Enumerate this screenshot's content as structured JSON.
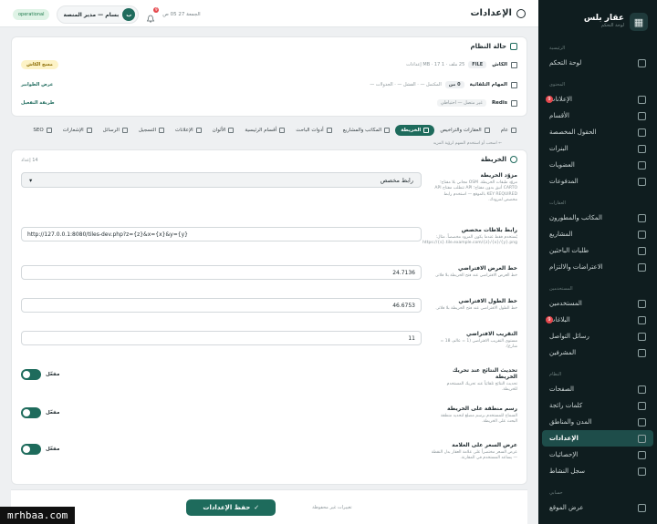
{
  "sidebar": {
    "brand": {
      "name": "عقار بلس",
      "sub": "لوحة التحكم"
    },
    "sections": [
      {
        "title": "الرئيسية",
        "items": [
          {
            "label": "لوحة التحكم",
            "badge": ""
          }
        ]
      },
      {
        "title": "المحتوى",
        "items": [
          {
            "label": "الإعلانات",
            "badge": "9"
          },
          {
            "label": "الأقسام",
            "badge": ""
          },
          {
            "label": "الحقول المخصصة",
            "badge": ""
          },
          {
            "label": "البنرات",
            "badge": ""
          },
          {
            "label": "العضويات",
            "badge": ""
          },
          {
            "label": "المدفوعات",
            "badge": ""
          }
        ]
      },
      {
        "title": "العقارات",
        "items": [
          {
            "label": "المكاتب والمطورون",
            "badge": ""
          },
          {
            "label": "المشاريع",
            "badge": ""
          },
          {
            "label": "طلبات الباحثين",
            "badge": ""
          },
          {
            "label": "الاعتراضات والالتزام",
            "badge": ""
          }
        ]
      },
      {
        "title": "المستخدمين",
        "items": [
          {
            "label": "المستخدمين",
            "badge": ""
          },
          {
            "label": "البلاغات",
            "badge": "9"
          },
          {
            "label": "رسائل التواصل",
            "badge": ""
          },
          {
            "label": "المشرفين",
            "badge": ""
          }
        ]
      },
      {
        "title": "النظام",
        "items": [
          {
            "label": "الصفحات",
            "badge": ""
          },
          {
            "label": "كلمات رائجة",
            "badge": ""
          },
          {
            "label": "المدن والمناطق",
            "badge": ""
          },
          {
            "label": "الإعدادات",
            "badge": "",
            "active": true
          },
          {
            "label": "الإحصائيات",
            "badge": ""
          },
          {
            "label": "سجل النشاط",
            "badge": ""
          }
        ]
      },
      {
        "title": "حسابي",
        "items": [
          {
            "label": "عرض الموقع",
            "badge": ""
          }
        ]
      }
    ]
  },
  "topbar": {
    "title": "الإعدادات",
    "date": "الجمعة 27 05 ص",
    "notif_count": "9",
    "user": "بسام — مدير المنصة",
    "avatar_letter": "ب",
    "status": "operational"
  },
  "system": {
    "title": "حالة النظام",
    "rows": [
      {
        "key": "الكاش",
        "chips": [
          "FILE"
        ],
        "meta": "25 ملف · 1 MB · 17 إعدادات",
        "action": "مسح الكاش"
      },
      {
        "key": "المهام التلقائية",
        "chips": [
          "0 من"
        ],
        "meta": "المكتمل — · الفشل — · الجدولات —",
        "action": "عرض الطوابير"
      },
      {
        "key": "Redis",
        "chips": [
          "غير متصل — احتياطي"
        ],
        "meta": "",
        "action": "طريقة التفعيل"
      }
    ]
  },
  "tabs": [
    {
      "label": "عام",
      "active": false
    },
    {
      "label": "العقارات والتراخيص",
      "active": false
    },
    {
      "label": "الخريطة",
      "active": true
    },
    {
      "label": "المكاتب والمشاريع",
      "active": false
    },
    {
      "label": "أدوات الباحث",
      "active": false
    },
    {
      "label": "أقسام الرئيسية",
      "active": false
    },
    {
      "label": "الألوان",
      "active": false
    },
    {
      "label": "الإعلانات",
      "active": false
    },
    {
      "label": "التسجيل",
      "active": false
    },
    {
      "label": "الرسائل",
      "active": false
    },
    {
      "label": "الإشعارات",
      "active": false
    },
    {
      "label": "SEO",
      "active": false
    }
  ],
  "hint": "← اسحب أو استخدم السهم لرؤية المزيد",
  "map": {
    "title": "الخريطة",
    "count": "14 إعداد",
    "fields": [
      {
        "label": "مزوّد الخريطة",
        "desc": "مزوّد طبقات الخريطة. OSM مجاني بلا مفتاح؛ CARTO أنيق بدون مفتاح؛ API تتطلب مفتاح API KEY REQUIRED بالموقع — استخدم رابط مخصص لمزودك.",
        "type": "select",
        "value": "رابط مخصص"
      },
      {
        "label": "رابط بلاطات مخصص",
        "desc": "يُستخدم فقط عندما يكون المزود مخصصاً. مثال: https://{s}.tile.example.com/{z}/{x}/{y}.png",
        "type": "input",
        "value": "http://127.0.0.1:8080/tiles-dev.php?z={z}&x={x}&y={y}"
      },
      {
        "label": "خط العرض الافتراضي",
        "desc": "خط العرض الافتراضي عند فتح الخريطة بلا فلاتر.",
        "type": "input",
        "value": "24.7136"
      },
      {
        "label": "خط الطول الافتراضي",
        "desc": "خط الطول الافتراضي عند فتح الخريطة بلا فلاتر.",
        "type": "input",
        "value": "46.6753"
      },
      {
        "label": "التقريب الافتراضي",
        "desc": "مستوى التقريب الافتراضي (1 = عالم، 18 = شارع).",
        "type": "input",
        "value": "11"
      },
      {
        "label": "تحديث النتائج عند تحريك الخريطة",
        "desc": "تحديث النتائج تلقائياً عند تحريك المستخدم للخريطة.",
        "type": "toggle",
        "value": "مفعّل"
      },
      {
        "label": "رسم منطقة على الخريطة",
        "desc": "السماح للمستخدم برسم مضلع لتحديد منطقة البحث على الخريطة.",
        "type": "toggle",
        "value": "مفعّل"
      },
      {
        "label": "عرض السعر على العلامة",
        "desc": "عرض السعر مختصراً على علامة العقار بدل النقطة — يساعد المستخدم في المقارنة.",
        "type": "toggle",
        "value": "مفعّل"
      }
    ]
  },
  "save": {
    "label": "حفظ الإعدادات",
    "unsaved": "تغييرات غير محفوظة"
  },
  "watermark": "mrhbaa.com",
  "colors": {
    "accent": "#1e6b5c",
    "sidebar": "#0f1d1f",
    "badge": "#e5484d"
  }
}
